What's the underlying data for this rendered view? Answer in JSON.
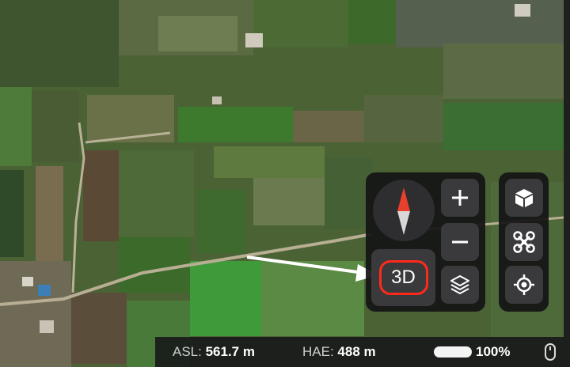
{
  "map": {
    "type": "satellite-imagery"
  },
  "controls": {
    "compass": {
      "icon": "compass-needle-icon"
    },
    "zoom_in": {
      "label": "+",
      "icon": "plus-icon"
    },
    "zoom_out": {
      "label": "−",
      "icon": "minus-icon"
    },
    "view_mode": {
      "label": "3D"
    },
    "layers": {
      "icon": "layers-icon"
    },
    "model": {
      "icon": "cube-icon"
    },
    "drone": {
      "icon": "drone-icon"
    },
    "locate": {
      "icon": "crosshair-target-icon"
    }
  },
  "annotation": {
    "arrow": "white-pointer-arrow",
    "highlight_color": "#ff2a1a"
  },
  "status": {
    "asl_label": "ASL:",
    "asl_value": "561.7 m",
    "hae_label": "HAE:",
    "hae_value": "488 m",
    "battery_percent": "100%",
    "battery_level": 1.0
  }
}
